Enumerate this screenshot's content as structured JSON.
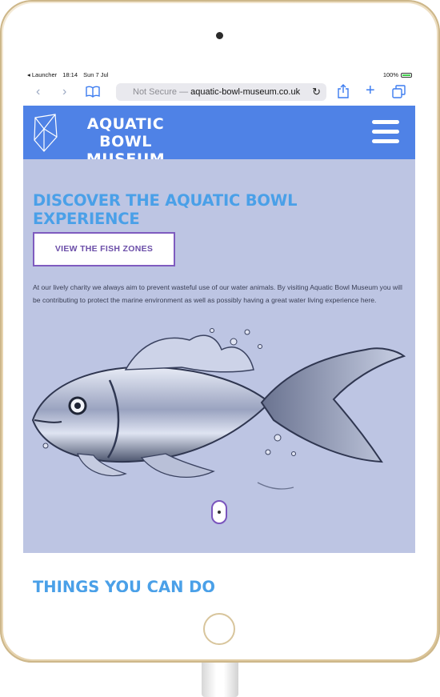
{
  "status_bar": {
    "back_app": "◂ Launcher",
    "time": "18:14",
    "date": "Sun 7 Jul",
    "battery": "100%"
  },
  "browser": {
    "security_label": "Not Secure —",
    "url": "aquatic-bowl-museum.co.uk",
    "icons": [
      "back-icon",
      "forward-icon",
      "bookmarks-icon",
      "reload-icon",
      "share-icon",
      "new-tab-icon",
      "tabs-icon"
    ]
  },
  "site": {
    "logo_line1": "AQUATIC BOWL",
    "logo_line2": "MUSEUM",
    "header_color": "#4f82e6"
  },
  "hero": {
    "title": "DISCOVER THE AQUATIC BOWL EXPERIENCE",
    "cta_label": "VIEW THE FISH ZONES",
    "body": "At our lively charity we always aim to prevent wasteful use of our water animals. By visiting Aquatic Bowl Museum you will be contributing to protect the marine environment as well as possibly having a great water living experience here.",
    "background": "#bdc5e3",
    "accent": "#4aa0e8"
  },
  "section2": {
    "title": "THINGS YOU CAN DO"
  }
}
